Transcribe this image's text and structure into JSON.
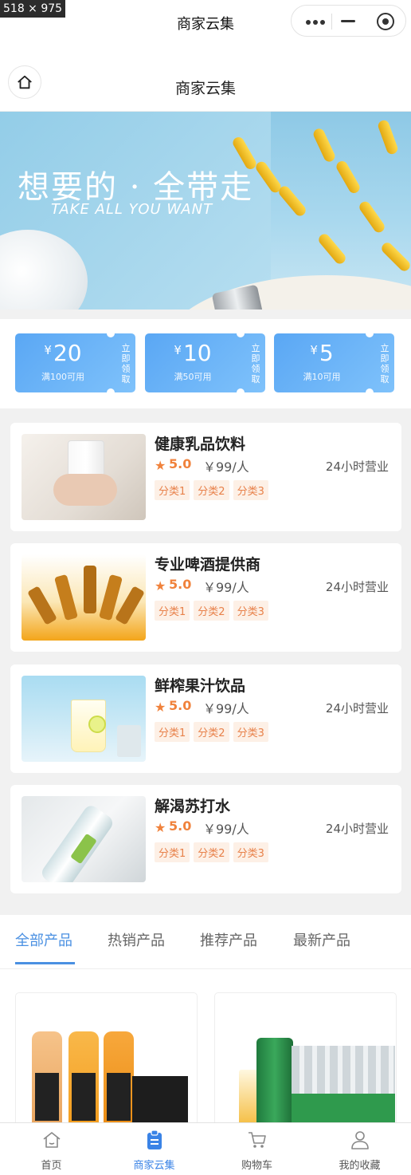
{
  "size_label": "518 × 975",
  "topbar": {
    "title": "商家云集"
  },
  "navbar": {
    "title": "商家云集"
  },
  "banner": {
    "headline": "想要的 · 全带走",
    "subtitle": "TAKE ALL YOU WANT"
  },
  "coupons": [
    {
      "currency": "¥",
      "amount": "20",
      "condition": "满100可用",
      "claim": "立即领取"
    },
    {
      "currency": "¥",
      "amount": "10",
      "condition": "满50可用",
      "claim": "立即领取"
    },
    {
      "currency": "¥",
      "amount": "5",
      "condition": "满10可用",
      "claim": "立即领取"
    }
  ],
  "shops": [
    {
      "name": "健康乳品饮料",
      "rating": "5.0",
      "price": "￥99/人",
      "hours": "24小时营业",
      "tags": [
        "分类1",
        "分类2",
        "分类3"
      ]
    },
    {
      "name": "专业啤酒提供商",
      "rating": "5.0",
      "price": "￥99/人",
      "hours": "24小时营业",
      "tags": [
        "分类1",
        "分类2",
        "分类3"
      ]
    },
    {
      "name": "鲜榨果汁饮品",
      "rating": "5.0",
      "price": "￥99/人",
      "hours": "24小时营业",
      "tags": [
        "分类1",
        "分类2",
        "分类3"
      ]
    },
    {
      "name": "解渴苏打水",
      "rating": "5.0",
      "price": "￥99/人",
      "hours": "24小时营业",
      "tags": [
        "分类1",
        "分类2",
        "分类3"
      ]
    }
  ],
  "tabs": [
    "全部产品",
    "热销产品",
    "推荐产品",
    "最新产品"
  ],
  "bottom_nav": [
    {
      "label": "首页",
      "icon": "home-icon"
    },
    {
      "label": "商家云集",
      "icon": "clipboard-icon"
    },
    {
      "label": "购物车",
      "icon": "cart-icon"
    },
    {
      "label": "我的收藏",
      "icon": "user-icon"
    }
  ],
  "colors": {
    "accent": "#4a90e2",
    "rating": "#f0823c",
    "tag_bg": "#fdf0e6",
    "coupon": "#5aa7f4"
  }
}
